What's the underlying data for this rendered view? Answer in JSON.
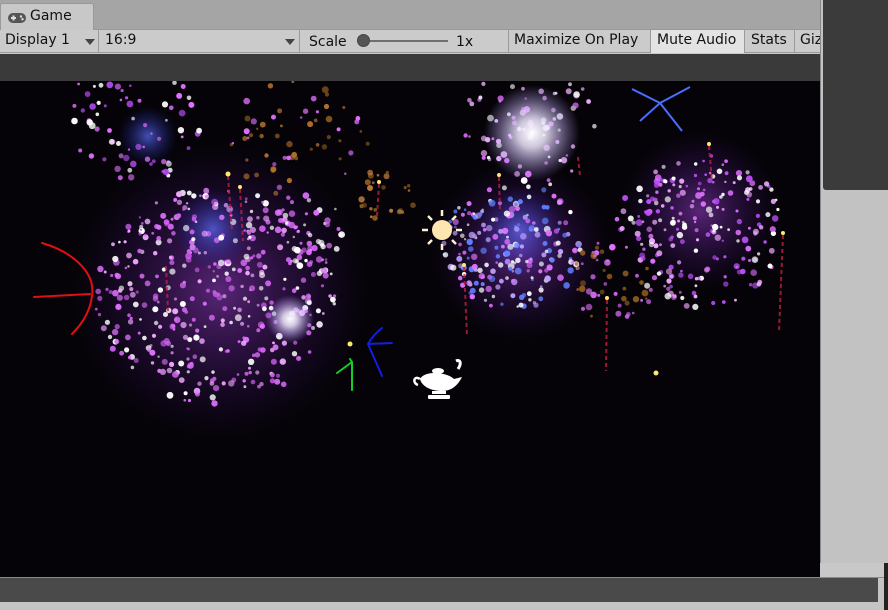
{
  "tab": {
    "label": "Game",
    "icon": "gamepad-icon"
  },
  "toolbar": {
    "display": "Display 1",
    "aspect": "16:9",
    "scale_label": "Scale",
    "scale_value": "1x",
    "scale_level": 0.0,
    "maximize": "Maximize On Play",
    "mute": "Mute Audio",
    "stats": "Stats",
    "gizmos": "Giz"
  },
  "game": {
    "background": "#050307",
    "accent_colors": [
      "#e070ff",
      "#a040ff",
      "#3050ff",
      "#ff3050",
      "#ffe060"
    ],
    "icons": [
      "sun-icon",
      "genie-lamp-icon",
      "red-annotation-arrow",
      "blue-annotation-arrow",
      "green-annotation-arrow"
    ]
  }
}
